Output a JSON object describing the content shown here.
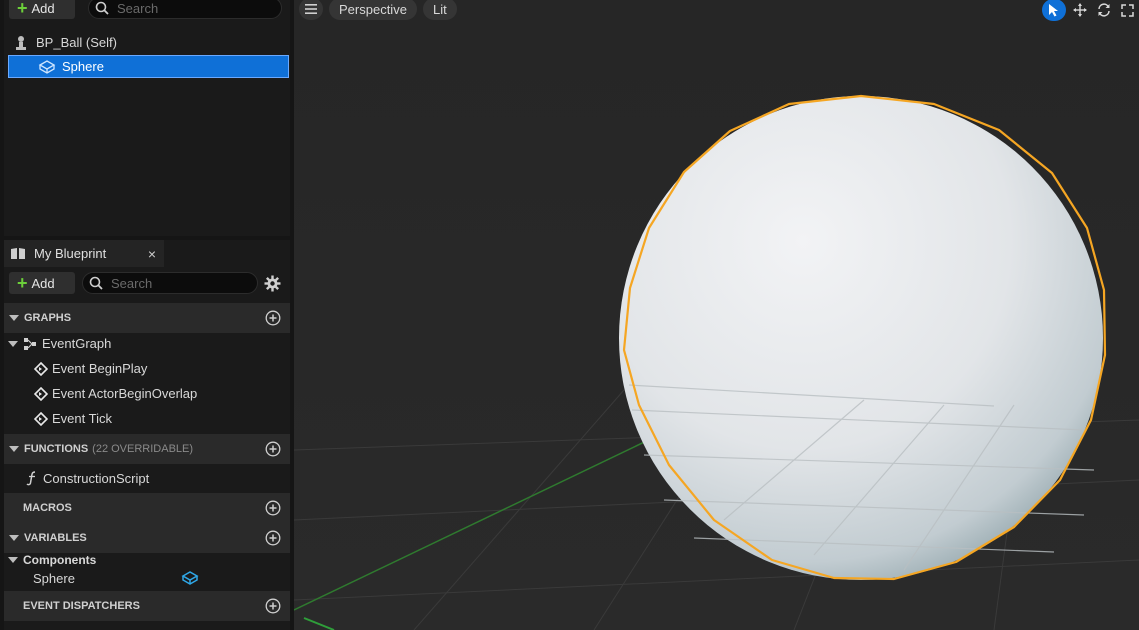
{
  "components": {
    "add_label": "Add",
    "search_placeholder": "Search",
    "tree": [
      {
        "label": "BP_Ball (Self)"
      },
      {
        "label": "Sphere"
      }
    ]
  },
  "blueprint": {
    "tab_title": "My Blueprint",
    "close_glyph": "×",
    "add_label": "Add",
    "search_placeholder": "Search",
    "sections": {
      "graphs": "GRAPHS",
      "functions": "FUNCTIONS",
      "functions_sub": "(22 OVERRIDABLE)",
      "macros": "MACROS",
      "variables": "VARIABLES",
      "event_dispatchers": "EVENT DISPATCHERS"
    },
    "graph_root": "EventGraph",
    "events": [
      "Event BeginPlay",
      "Event ActorBeginOverlap",
      "Event Tick"
    ],
    "functions": [
      "ConstructionScript"
    ],
    "components_category": "Components",
    "component_vars": [
      "Sphere"
    ]
  },
  "viewport": {
    "view_mode": "Perspective",
    "lighting_mode": "Lit",
    "tools": [
      "select-icon",
      "translate-icon",
      "rotate-icon",
      "maximize-icon"
    ]
  },
  "colors": {
    "selection": "#0f70d7",
    "outline": "#f5a623",
    "add_plus": "#6ccf3a"
  }
}
